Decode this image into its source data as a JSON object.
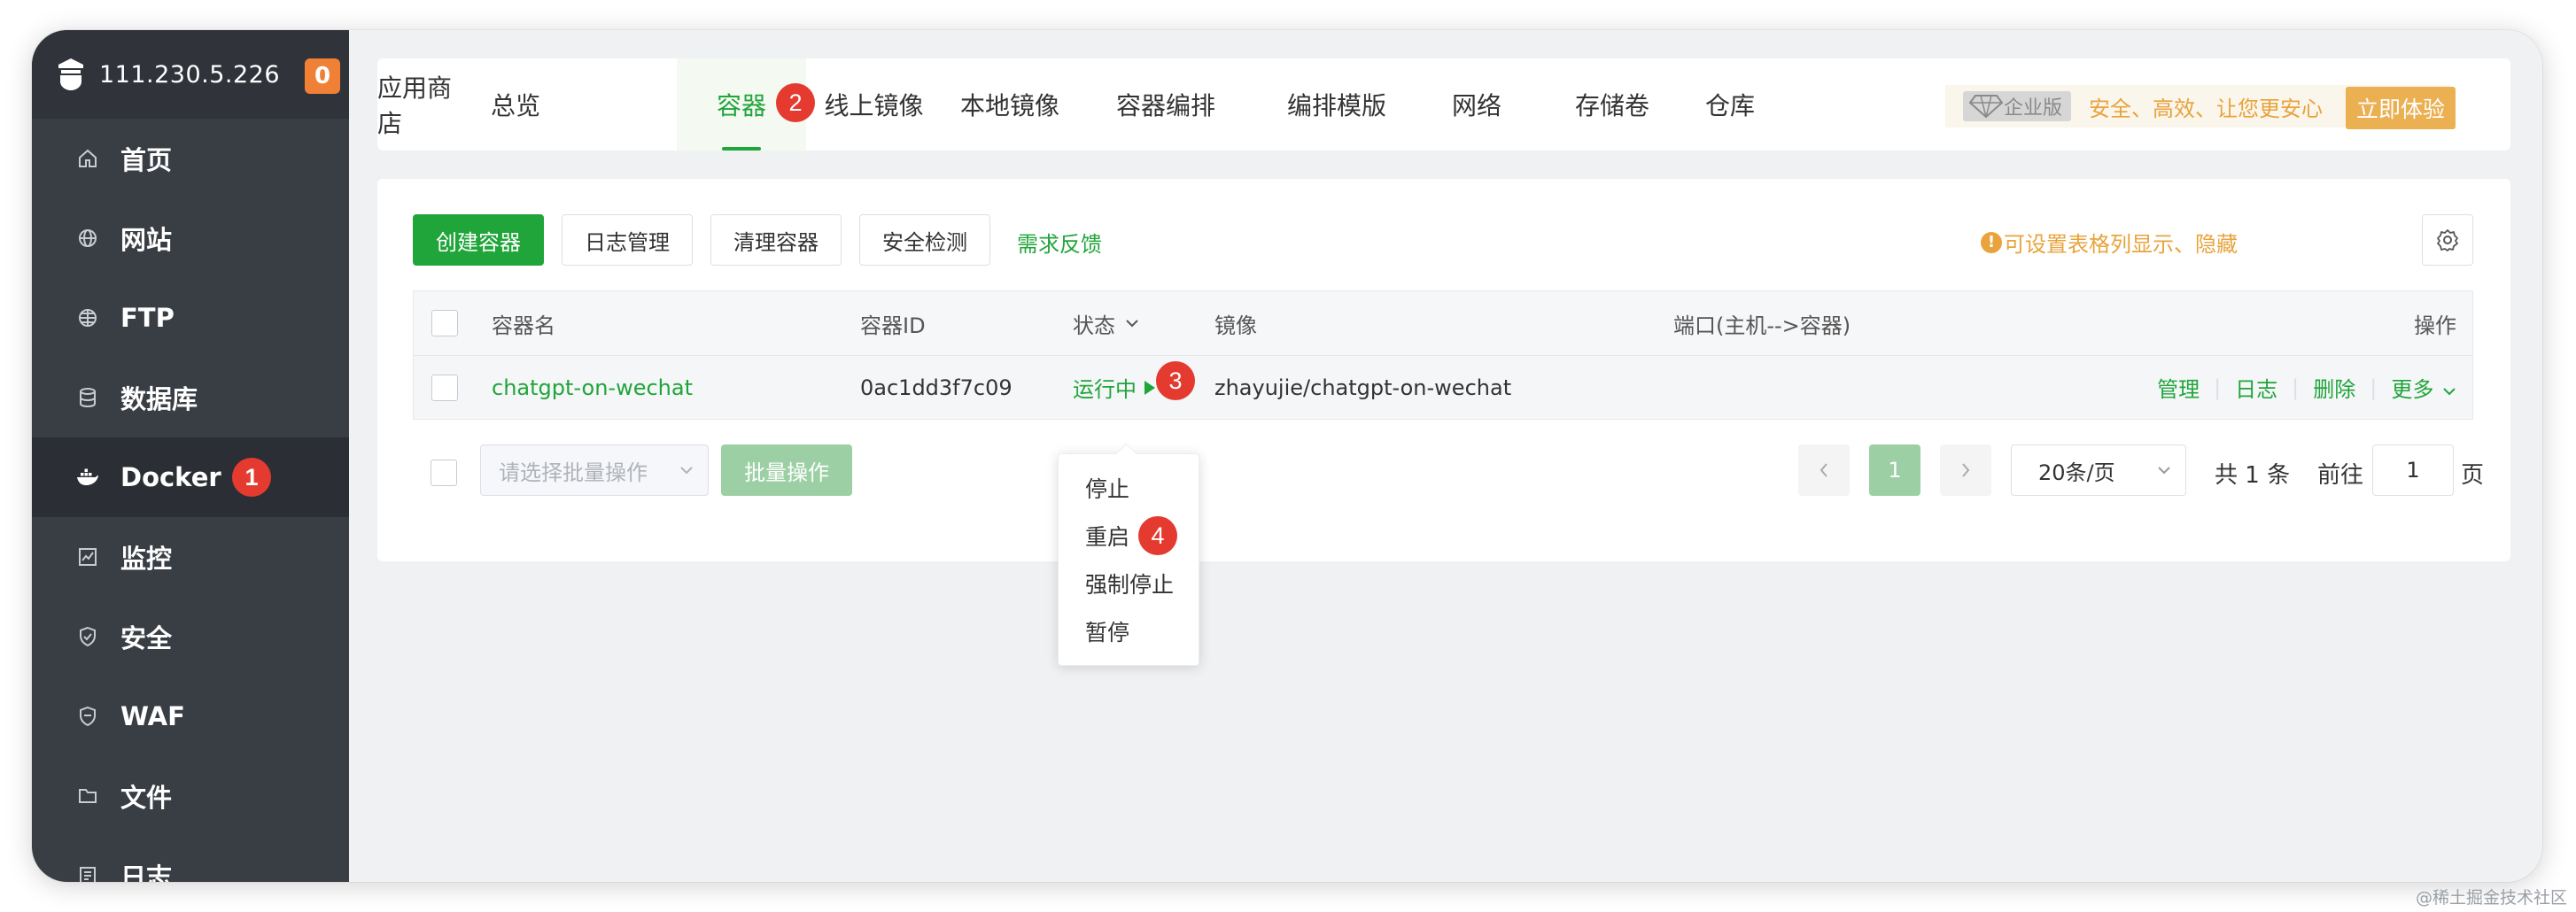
{
  "sidebar": {
    "server_ip": "111.230.5.226",
    "message_count": "0",
    "items": [
      {
        "label": "首页",
        "icon": "home-icon"
      },
      {
        "label": "网站",
        "icon": "globe-icon"
      },
      {
        "label": "FTP",
        "icon": "ftp-globe-icon"
      },
      {
        "label": "数据库",
        "icon": "database-icon"
      },
      {
        "label": "Docker",
        "icon": "docker-icon",
        "active": true,
        "step": "1"
      },
      {
        "label": "监控",
        "icon": "monitor-icon"
      },
      {
        "label": "安全",
        "icon": "shield-icon"
      },
      {
        "label": "WAF",
        "icon": "waf-shield-icon"
      },
      {
        "label": "文件",
        "icon": "folder-icon"
      },
      {
        "label": "日志",
        "icon": "log-icon"
      }
    ]
  },
  "tabs": {
    "items": [
      "应用商店",
      "总览",
      "容器",
      "线上镜像",
      "本地镜像",
      "容器编排",
      "编排模版",
      "网络",
      "存储卷",
      "仓库"
    ],
    "active": "容器",
    "step": "2"
  },
  "promo": {
    "badge": "企业版",
    "text": "安全、高效、让您更安心",
    "button": "立即体验"
  },
  "toolbar": {
    "create": "创建容器",
    "logs": "日志管理",
    "clean": "清理容器",
    "security": "安全检测",
    "feedback": "需求反馈",
    "tip": "可设置表格列显示、隐藏"
  },
  "table": {
    "headers": {
      "name": "容器名",
      "id": "容器ID",
      "status": "状态",
      "image": "镜像",
      "port": "端口(主机-->容器)",
      "ops": "操作"
    },
    "rows": [
      {
        "name": "chatgpt-on-wechat",
        "id": "0ac1dd3f7c09",
        "status": "运行中",
        "status_step": "3",
        "image": "zhayujie/chatgpt-on-wechat",
        "port": "",
        "ops": [
          "管理",
          "日志",
          "删除",
          "更多"
        ]
      }
    ]
  },
  "bulk": {
    "placeholder": "请选择批量操作",
    "button": "批量操作"
  },
  "pagination": {
    "current_page": "1",
    "page_size": "20条/页",
    "total": "共 1 条",
    "goto_label": "前往",
    "goto_value": "1",
    "goto_suffix": "页"
  },
  "status_menu": {
    "items": [
      "停止",
      "重启",
      "强制停止",
      "暂停"
    ],
    "step": "4"
  },
  "watermark": "@稀土掘金技术社区",
  "colors": {
    "accent": "#20a53a",
    "sidebar_bg": "#393d44",
    "badge_red": "#e53a2f",
    "promo_gold": "#eab052",
    "count_orange": "#f08036"
  }
}
